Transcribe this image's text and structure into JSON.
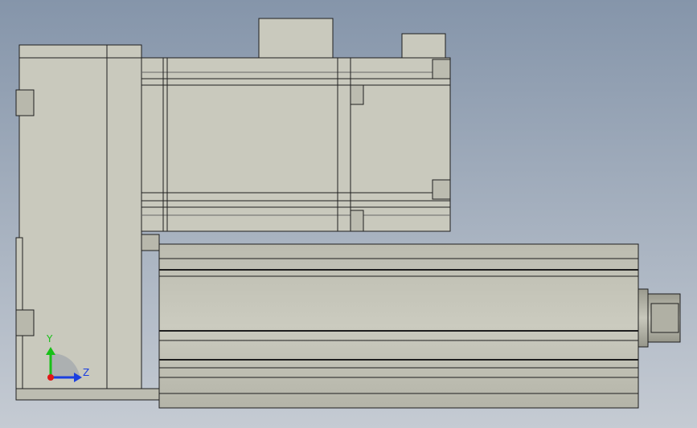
{
  "view": {
    "background_top": "#8595aa",
    "background_bottom": "#c5cbd3",
    "part_fill": "#c9c9bd",
    "part_shade": "#a8a89c",
    "edge_color": "#1e1e1e"
  },
  "triad": {
    "y_label": "Y",
    "z_label": "Z",
    "y_color": "#18c018",
    "z_color": "#1a3ee0",
    "origin_color": "#e01818"
  }
}
